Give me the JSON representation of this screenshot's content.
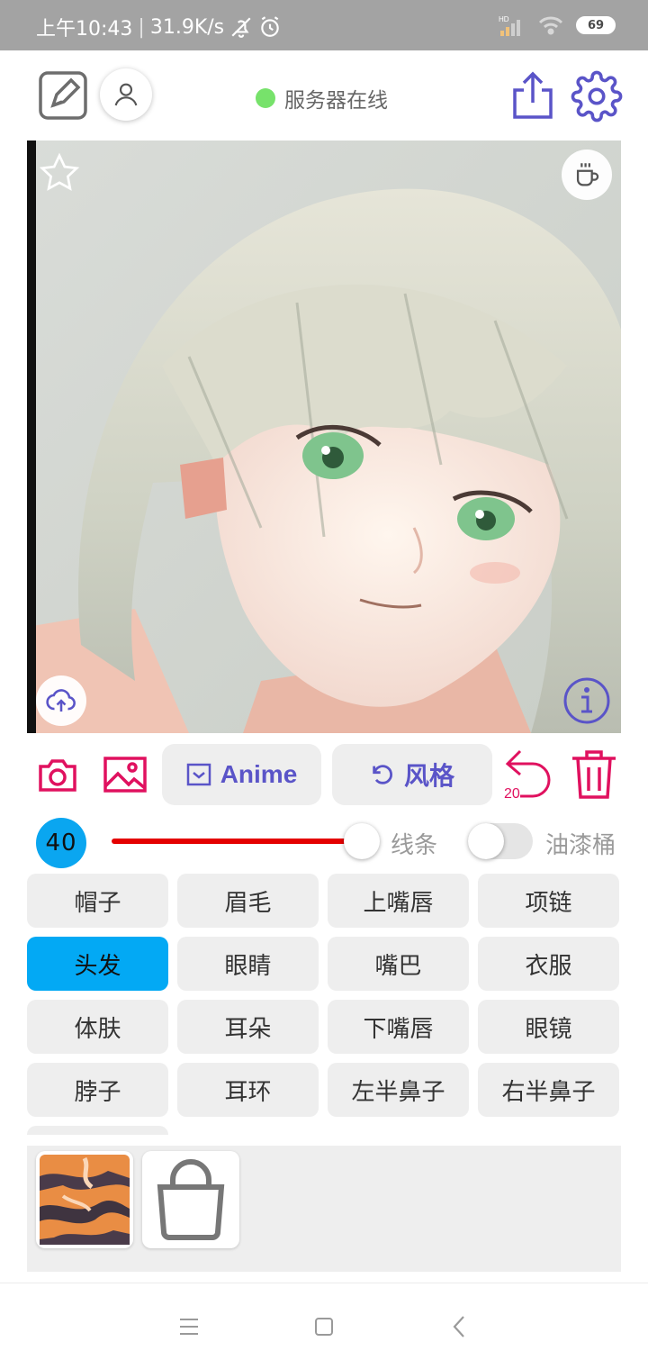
{
  "status_bar": {
    "time": "上午10:43",
    "net_speed": "31.9K/s",
    "battery": "69",
    "network_label": "HD"
  },
  "header": {
    "server_status": "服务器在线",
    "status_color": "#77e26b"
  },
  "tools": {
    "anime_label": "Anime",
    "style_label": "风格",
    "undo_count": "20",
    "accent_pink": "#e0115f",
    "accent_purple": "#5a54c8"
  },
  "brush": {
    "size": "40",
    "line_label": "线条",
    "bucket_label": "油漆桶",
    "line_toggle_value": 0.7
  },
  "parts": [
    {
      "label": "帽子"
    },
    {
      "label": "眉毛"
    },
    {
      "label": "上嘴唇"
    },
    {
      "label": "项链"
    },
    {
      "label": "头发",
      "active": true
    },
    {
      "label": "眼睛"
    },
    {
      "label": "嘴巴"
    },
    {
      "label": "衣服"
    },
    {
      "label": "体肤"
    },
    {
      "label": "耳朵"
    },
    {
      "label": "下嘴唇"
    },
    {
      "label": "眼镜"
    },
    {
      "label": "脖子"
    },
    {
      "label": "耳环"
    },
    {
      "label": "左半鼻子"
    },
    {
      "label": "右半鼻子"
    }
  ],
  "icons": [
    "edit-icon",
    "user-icon",
    "share-icon",
    "gear-icon",
    "star-icon",
    "coffee-icon",
    "upload-cloud-icon",
    "info-icon",
    "camera-icon",
    "image-icon",
    "mail-icon",
    "rotate-icon",
    "undo-icon",
    "trash-icon",
    "lock-icon"
  ]
}
